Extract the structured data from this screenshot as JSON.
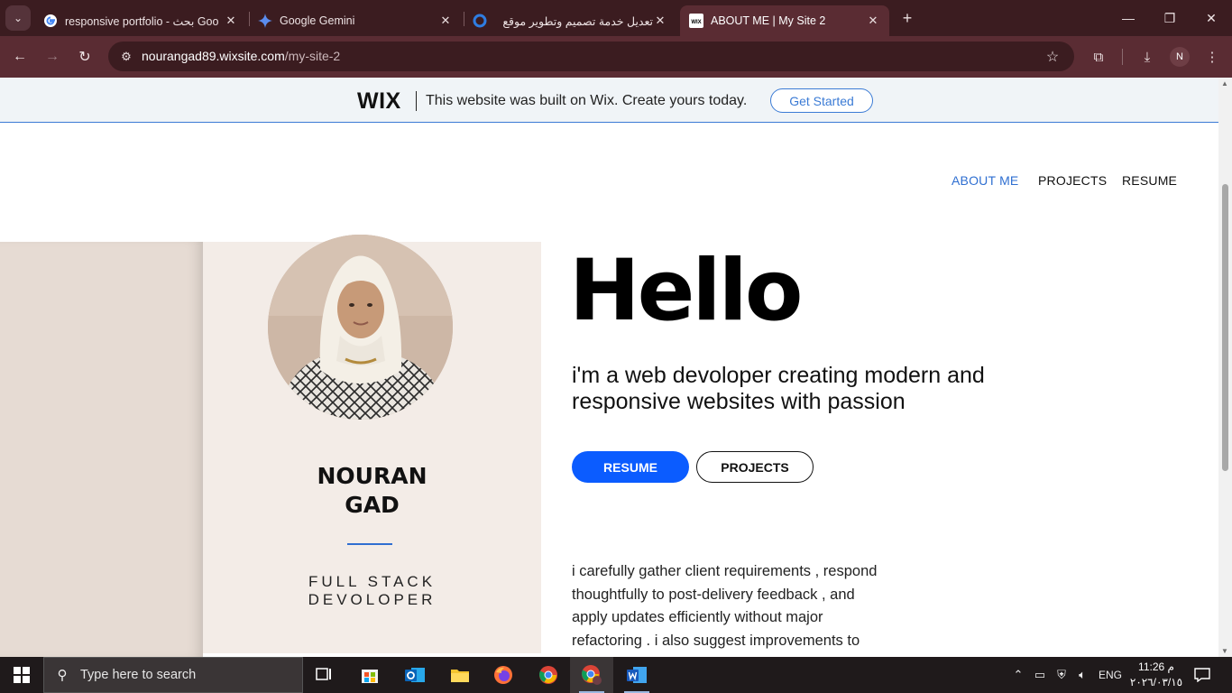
{
  "browser": {
    "tabs": [
      {
        "title": "responsive portfolio - بحث Goo",
        "icon": "google-icon"
      },
      {
        "title": "Google Gemini",
        "icon": "gemini-icon"
      },
      {
        "title": "تعديل خدمة تصميم وتطوير موقع",
        "icon": "site-icon"
      },
      {
        "title": "ABOUT ME | My Site 2",
        "icon": "wix-icon"
      }
    ],
    "url_host": "nourangad89.wixsite.com",
    "url_path": "/my-site-2",
    "profile_initial": "N"
  },
  "wix_banner": {
    "logo": "WIX",
    "message": "This website was built on Wix. Create yours today.",
    "cta": "Get Started"
  },
  "site_nav": {
    "items": [
      "ABOUT ME",
      "PROJECTS",
      "RESUME"
    ],
    "active": "ABOUT ME"
  },
  "profile": {
    "name_line1": "NOURAN",
    "name_line2": "GAD",
    "role_line1": "FULL STACK",
    "role_line2": "DEVOLOPER"
  },
  "hero": {
    "greeting": "Hello",
    "tagline_line1": "i'm a web devoloper creating modern and",
    "tagline_line2": "responsive websites with passion",
    "btn_resume": "RESUME",
    "btn_projects": "PROJECTS",
    "about_lines": [
      "i carefully gather client requirements , respond",
      "thoughtfully to post-delivery feedback  , and",
      "apply updates efficiently without major",
      "refactoring . i also suggest improvements to"
    ]
  },
  "taskbar": {
    "search_placeholder": "Type here to search",
    "language": "ENG",
    "time": "11:26 م",
    "date": "٢٠٢٦/٠٣/١٥"
  },
  "colors": {
    "accent_blue": "#0b5cff",
    "nav_active": "#2f6fd1",
    "chrome_dark": "#3b1c20",
    "chrome_toolbar": "#5a2c33",
    "card_bg": "#f3ece7"
  }
}
